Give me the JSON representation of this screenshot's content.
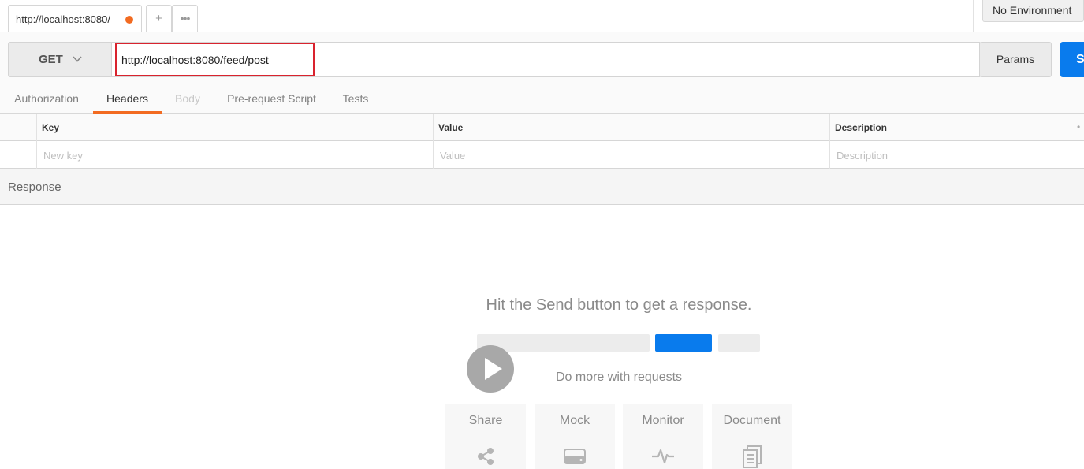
{
  "tabbar": {
    "active_tab_title": "http://localhost:8080/",
    "new_tab_symbol": "+",
    "more_symbol": "•••"
  },
  "environment": {
    "selected": "No Environment"
  },
  "request": {
    "method": "GET",
    "url": "http://localhost:8080/feed/post",
    "params_label": "Params",
    "send_label": "Send"
  },
  "request_tabs": [
    {
      "label": "Authorization",
      "state": "normal"
    },
    {
      "label": "Headers",
      "state": "active"
    },
    {
      "label": "Body",
      "state": "disabled"
    },
    {
      "label": "Pre-request Script",
      "state": "normal"
    },
    {
      "label": "Tests",
      "state": "normal"
    }
  ],
  "headers_table": {
    "columns": [
      "Key",
      "Value",
      "Description"
    ],
    "placeholders": [
      "New key",
      "Value",
      "Description"
    ]
  },
  "response": {
    "title": "Response",
    "empty_message": "Hit the Send button to get a response.",
    "more_label": "Do more with requests",
    "features": [
      {
        "label": "Share",
        "icon": "share-icon"
      },
      {
        "label": "Mock",
        "icon": "mock-server-icon"
      },
      {
        "label": "Monitor",
        "icon": "monitor-pulse-icon"
      },
      {
        "label": "Document",
        "icon": "document-icon"
      }
    ]
  },
  "colors": {
    "accent_orange": "#f26b21",
    "send_blue": "#097bed",
    "highlight_red": "#d9232e"
  }
}
